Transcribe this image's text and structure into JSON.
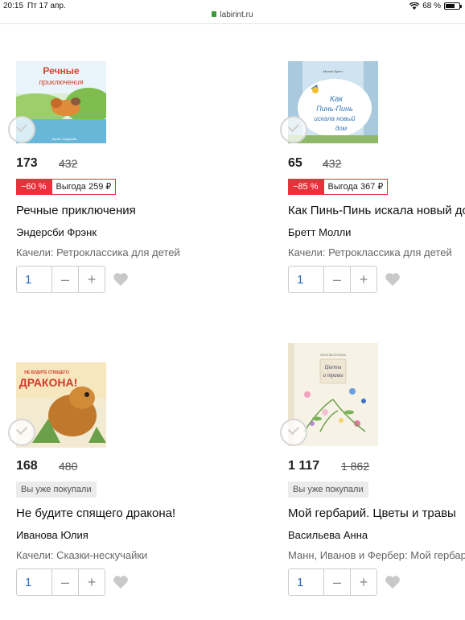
{
  "status_bar": {
    "time": "20:15",
    "date": "Пт 17 апр.",
    "url": "labirint.ru",
    "battery": "68 %",
    "battery_level": 0.68
  },
  "products": [
    {
      "price": "173",
      "old_price": "432",
      "discount": "−60 %",
      "benefit": "Выгода 259 ₽",
      "title": "Речные приключения",
      "author": "Эндерсби Фрэнк",
      "series": "Качели: Ретроклассика для детей",
      "quantity": "1",
      "cover_title": "Речные приключения"
    },
    {
      "price": "65",
      "old_price": "432",
      "discount": "−85 %",
      "benefit": "Выгода 367 ₽",
      "title": "Как Пинь-Пинь искала новый до",
      "author": "Бретт Молли",
      "series": "Качели: Ретроклассика для детей",
      "quantity": "1",
      "cover_title": "Как Пинь-Пинь искала новый дом"
    },
    {
      "price": "168",
      "old_price": "480",
      "bought": "Вы уже покупали",
      "title": "Не будите спящего дракона!",
      "author": "Иванова Юлия",
      "series": "Качели: Сказки-нескучайки",
      "quantity": "1",
      "cover_title": "Не будите спящего дракона!"
    },
    {
      "price": "1 117",
      "old_price": "1 862",
      "bought": "Вы уже покупали",
      "title": "Мой гербарий. Цветы и травы",
      "author": "Васильева Анна",
      "series": "Манн, Иванов и Фербер: Мой гербар",
      "quantity": "1",
      "cover_title": "Цветы и травы"
    }
  ],
  "controls": {
    "minus": "–",
    "plus": "+"
  },
  "colors": {
    "discount_red": "#e8313a",
    "link_blue": "#2a6ab8"
  }
}
